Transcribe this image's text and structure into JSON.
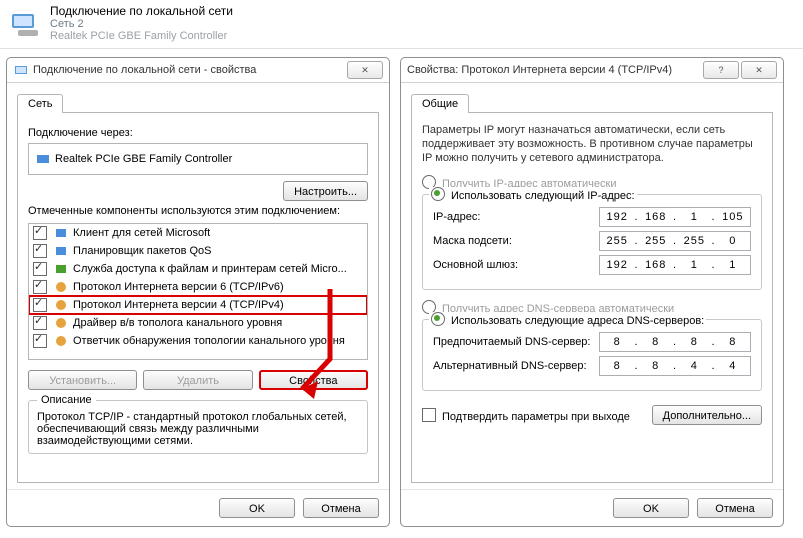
{
  "header": {
    "line1": "Подключение по локальной сети",
    "line2": "Сеть 2",
    "line3": "Realtek PCIe GBE Family Controller"
  },
  "leftWin": {
    "title": "Подключение по локальной сети - свойства",
    "tab": "Сеть",
    "connectUsingLabel": "Подключение через:",
    "adapter": "Realtek PCIe GBE Family Controller",
    "configureBtn": "Настроить...",
    "componentsLabel": "Отмеченные компоненты используются этим подключением:",
    "items": [
      {
        "label": "Клиент для сетей Microsoft",
        "checked": true
      },
      {
        "label": "Планировщик пакетов QoS",
        "checked": true
      },
      {
        "label": "Служба доступа к файлам и принтерам сетей Micro...",
        "checked": true
      },
      {
        "label": "Протокол Интернета версии 6 (TCP/IPv6)",
        "checked": true
      },
      {
        "label": "Протокол Интернета версии 4 (TCP/IPv4)",
        "checked": true,
        "highlight": true
      },
      {
        "label": "Драйвер в/в тополога канального уровня",
        "checked": true
      },
      {
        "label": "Ответчик обнаружения топологии канального уровня",
        "checked": true
      }
    ],
    "installBtn": "Установить...",
    "uninstallBtn": "Удалить",
    "propertiesBtn": "Свойства",
    "descTitle": "Описание",
    "descText": "Протокол TCP/IP - стандартный протокол глобальных сетей, обеспечивающий связь между различными взаимодействующими сетями.",
    "ok": "OK",
    "cancel": "Отмена"
  },
  "rightWin": {
    "title": "Свойства: Протокол Интернета версии 4 (TCP/IPv4)",
    "tab": "Общие",
    "intro": "Параметры IP могут назначаться автоматически, если сеть поддерживает эту возможность. В противном случае параметры IP можно получить у сетевого администратора.",
    "radioAutoIp": "Получить IP-адрес автоматически",
    "radioManualIp": "Использовать следующий IP-адрес:",
    "ipLabel": "IP-адрес:",
    "ip": [
      "192",
      "168",
      "1",
      "105"
    ],
    "maskLabel": "Маска подсети:",
    "mask": [
      "255",
      "255",
      "255",
      "0"
    ],
    "gatewayLabel": "Основной шлюз:",
    "gateway": [
      "192",
      "168",
      "1",
      "1"
    ],
    "radioAutoDns": "Получить адрес DNS-сервера автоматически",
    "radioManualDns": "Использовать следующие адреса DNS-серверов:",
    "dns1Label": "Предпочитаемый DNS-сервер:",
    "dns1": [
      "8",
      "8",
      "8",
      "8"
    ],
    "dns2Label": "Альтернативный DNS-сервер:",
    "dns2": [
      "8",
      "8",
      "4",
      "4"
    ],
    "validateChk": "Подтвердить параметры при выходе",
    "advancedBtn": "Дополнительно...",
    "ok": "OK",
    "cancel": "Отмена"
  }
}
